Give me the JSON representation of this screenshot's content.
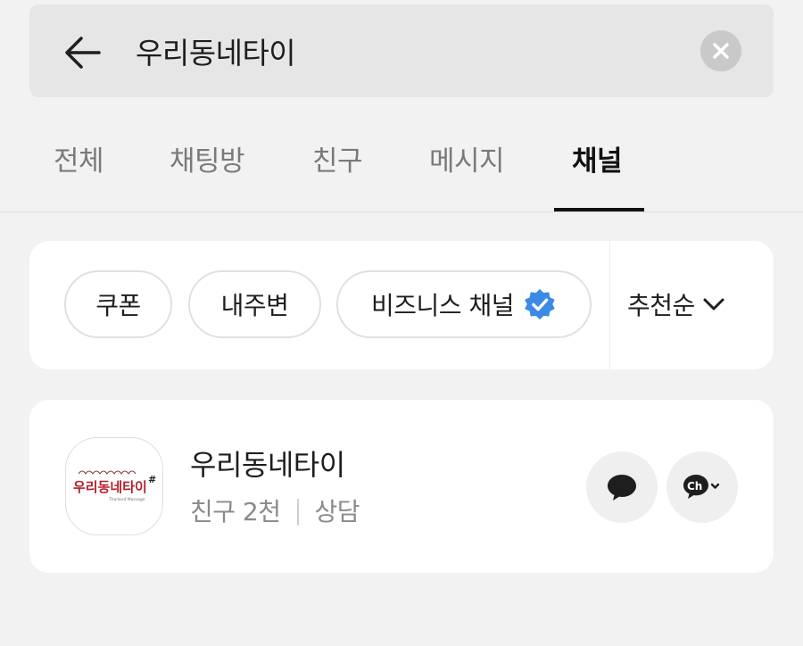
{
  "search": {
    "query": "우리동네타이"
  },
  "tabs": [
    {
      "label": "전체"
    },
    {
      "label": "채팅방"
    },
    {
      "label": "친구"
    },
    {
      "label": "메시지"
    },
    {
      "label": "채널",
      "active": true
    }
  ],
  "filters": {
    "chips": [
      {
        "label": "쿠폰"
      },
      {
        "label": "내주변"
      },
      {
        "label": "비즈니스 채널",
        "icon": "verified-badge-icon"
      }
    ],
    "sort_label": "추천순",
    "accent_color": "#3b8ae6"
  },
  "result": {
    "name": "우리동네타이",
    "friends": "친구 2천",
    "tag": "상담",
    "logo_text": "우리동네타이",
    "logo_suffix": "#",
    "logo_subtext": "Thailand Massage"
  }
}
